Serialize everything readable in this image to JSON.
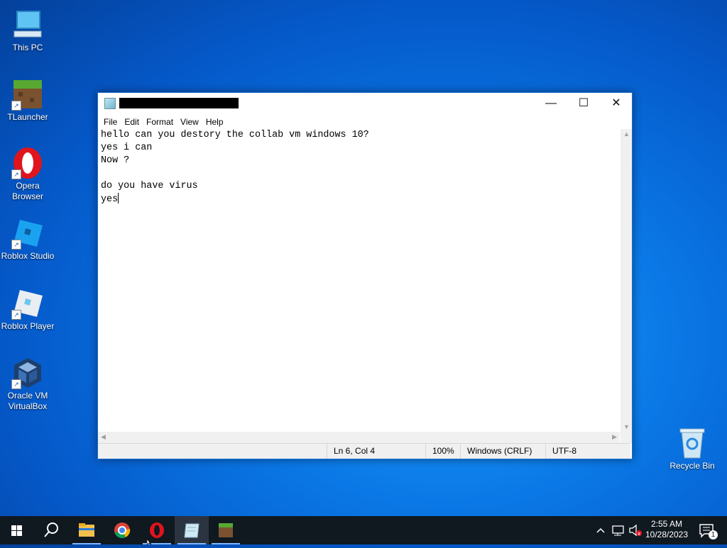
{
  "desktop": {
    "icons": [
      {
        "label": "This PC",
        "icon": "this-pc-icon"
      },
      {
        "label": "TLauncher",
        "icon": "tlauncher-icon"
      },
      {
        "label": "Opera Browser",
        "icon": "opera-icon"
      },
      {
        "label": "Roblox Studio",
        "icon": "roblox-studio-icon"
      },
      {
        "label": "Roblox Player",
        "icon": "roblox-player-icon"
      },
      {
        "label": "Oracle VM VirtualBox",
        "icon": "virtualbox-icon"
      },
      {
        "label": "Recycle Bin",
        "icon": "recycle-bin-icon"
      }
    ]
  },
  "notepad": {
    "menu": [
      "File",
      "Edit",
      "Format",
      "View",
      "Help"
    ],
    "lines": [
      "hello can you destory the collab vm windows 10?",
      "yes i can",
      "Now ?",
      "",
      "do you have virus",
      "yes"
    ],
    "status": {
      "position": "Ln 6, Col 4",
      "zoom": "100%",
      "line_ending": "Windows (CRLF)",
      "encoding": "UTF-8"
    }
  },
  "taskbar": {
    "apps": [
      "start",
      "search",
      "file-explorer",
      "chrome",
      "opera",
      "notepad",
      "tlauncher"
    ],
    "active_app": "notepad",
    "clock": {
      "time": "2:55 AM",
      "date": "10/28/2023"
    },
    "notification_count": "1"
  },
  "colors": {
    "desktop_blue": "#0a78e6",
    "taskbar": "#101820",
    "accent": "#7db6ff"
  }
}
